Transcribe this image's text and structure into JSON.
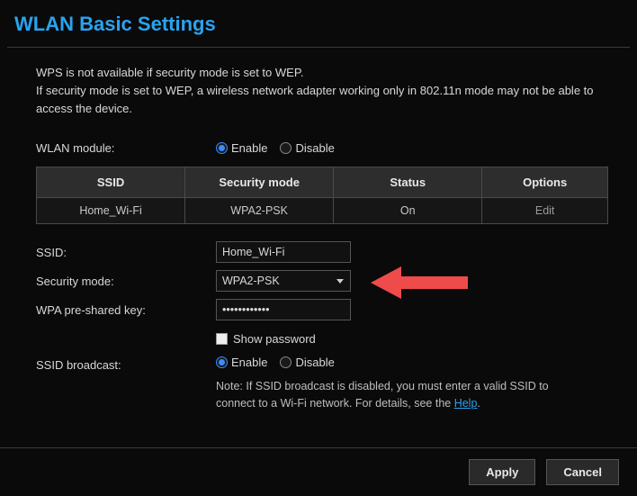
{
  "title": "WLAN Basic Settings",
  "warning": {
    "line1": "WPS is not available if security mode is set to WEP.",
    "line2": "If security mode is set to WEP, a wireless network adapter working only in 802.11n mode may not be able to access the device."
  },
  "wlan_module": {
    "label": "WLAN module:",
    "enable": "Enable",
    "disable": "Disable",
    "value": "enable"
  },
  "table": {
    "headers": {
      "ssid": "SSID",
      "security_mode": "Security mode",
      "status": "Status",
      "options": "Options"
    },
    "rows": [
      {
        "ssid": "Home_Wi-Fi",
        "security_mode": "WPA2-PSK",
        "status": "On",
        "options": "Edit"
      }
    ]
  },
  "form": {
    "ssid": {
      "label": "SSID:",
      "value": "Home_Wi-Fi"
    },
    "security_mode": {
      "label": "Security mode:",
      "value": "WPA2-PSK"
    },
    "wpa_key": {
      "label": "WPA pre-shared key:",
      "value": "••••••••••••"
    },
    "show_password": {
      "label": "Show password",
      "checked": false
    },
    "ssid_broadcast": {
      "label": "SSID broadcast:",
      "enable": "Enable",
      "disable": "Disable",
      "value": "enable",
      "note_prefix": "Note: If SSID broadcast is disabled, you must enter a valid SSID to connect to a Wi-Fi network. For details, see the ",
      "note_link": "Help",
      "note_suffix": "."
    }
  },
  "buttons": {
    "apply": "Apply",
    "cancel": "Cancel"
  }
}
